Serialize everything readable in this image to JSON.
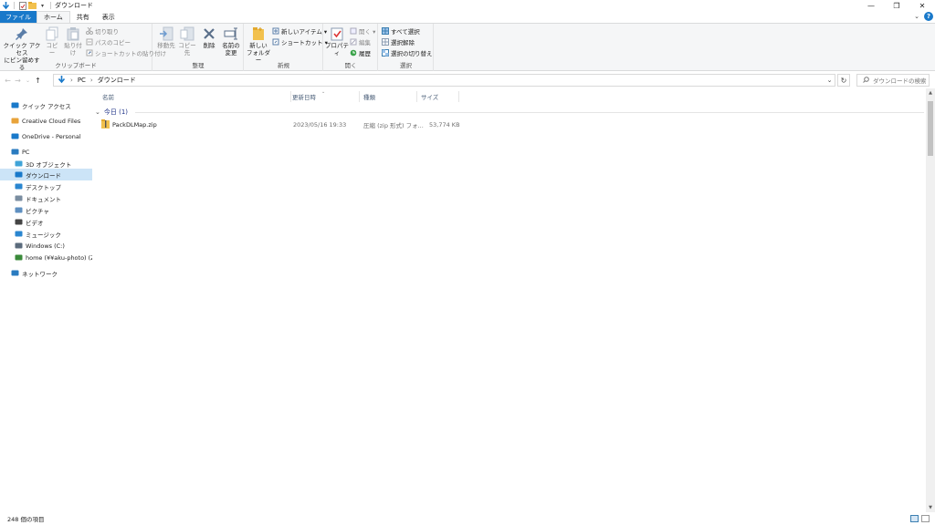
{
  "window": {
    "title": "ダウンロード"
  },
  "quick_access_toolbar": {
    "icons": [
      "down-arrow-icon",
      "properties-icon",
      "new-folder-icon",
      "customize-icon"
    ]
  },
  "tabs": [
    {
      "label": "ファイル"
    },
    {
      "label": "ホーム"
    },
    {
      "label": "共有"
    },
    {
      "label": "表示"
    }
  ],
  "ribbon": {
    "clipboard": {
      "label": "クリップボード",
      "pin_line1": "クイック アクセス",
      "pin_line2": "にピン留めする",
      "copy": "コピー",
      "paste": "貼り付け",
      "cut": "切り取り",
      "copy_path": "パスのコピー",
      "paste_shortcut": "ショートカットの貼り付け"
    },
    "organize": {
      "label": "整理",
      "move_to": "移動先",
      "copy_to": "コピー先",
      "delete": "削除",
      "rename_line1": "名前の",
      "rename_line2": "変更"
    },
    "new": {
      "label": "新規",
      "new_folder_line1": "新しい",
      "new_folder_line2": "フォルダー",
      "new_item": "新しいアイテム ▾",
      "shortcut": "ショートカット ▾"
    },
    "open": {
      "label": "開く",
      "properties": "プロパティ",
      "open": "開く ▾",
      "edit": "編集",
      "history": "履歴"
    },
    "select": {
      "label": "選択",
      "select_all": "すべて選択",
      "select_none": "選択解除",
      "invert": "選択の切り替え"
    }
  },
  "address": {
    "crumbs": [
      "PC",
      "ダウンロード"
    ],
    "search_placeholder": "ダウンロードの検索"
  },
  "nav_pane": [
    {
      "label": "クイック アクセス",
      "icon": "star-icon",
      "color": "#1979ca",
      "indent": 0
    },
    {
      "label": "Creative Cloud Files",
      "icon": "cc-folder-icon",
      "color": "#e8a33a",
      "indent": 0
    },
    {
      "label": "OneDrive - Personal",
      "icon": "cloud-icon",
      "color": "#1979ca",
      "indent": 0
    },
    {
      "label": "PC",
      "icon": "computer-icon",
      "color": "#2a7bc0",
      "indent": 0
    },
    {
      "label": "3D オブジェクト",
      "icon": "cube-icon",
      "color": "#40a4d8",
      "indent": 1
    },
    {
      "label": "ダウンロード",
      "icon": "download-folder-icon",
      "color": "#1979ca",
      "indent": 1,
      "selected": true
    },
    {
      "label": "デスクトップ",
      "icon": "desktop-icon",
      "color": "#2a86d0",
      "indent": 1
    },
    {
      "label": "ドキュメント",
      "icon": "document-icon",
      "color": "#7a8da0",
      "indent": 1
    },
    {
      "label": "ピクチャ",
      "icon": "pictures-icon",
      "color": "#5e8fc0",
      "indent": 1
    },
    {
      "label": "ビデオ",
      "icon": "video-icon",
      "color": "#444444",
      "indent": 1
    },
    {
      "label": "ミュージック",
      "icon": "music-icon",
      "color": "#2a86d0",
      "indent": 1
    },
    {
      "label": "Windows (C:)",
      "icon": "drive-icon",
      "color": "#5b6b7c",
      "indent": 1
    },
    {
      "label": "home (¥¥aku-photo) (Z:)",
      "icon": "network-drive-icon",
      "color": "#3a8a3a",
      "indent": 1
    },
    {
      "label": "ネットワーク",
      "icon": "network-icon",
      "color": "#2a7bc0",
      "indent": 0
    }
  ],
  "columns": {
    "name": "名前",
    "modified": "更新日時",
    "type": "種類",
    "size": "サイズ"
  },
  "group": {
    "label": "今日 (1)"
  },
  "files": [
    {
      "name": "PackDLMap.zip",
      "modified": "2023/05/16 19:33",
      "type": "圧縮 (zip 形式) フォ...",
      "size": "53,774 KB",
      "icon": "zip-folder-icon"
    }
  ],
  "status": {
    "item_count": "248 個の項目"
  },
  "colors": {
    "accent": "#1979ca",
    "selection": "#cce4f7",
    "group_text": "#1e3287"
  }
}
